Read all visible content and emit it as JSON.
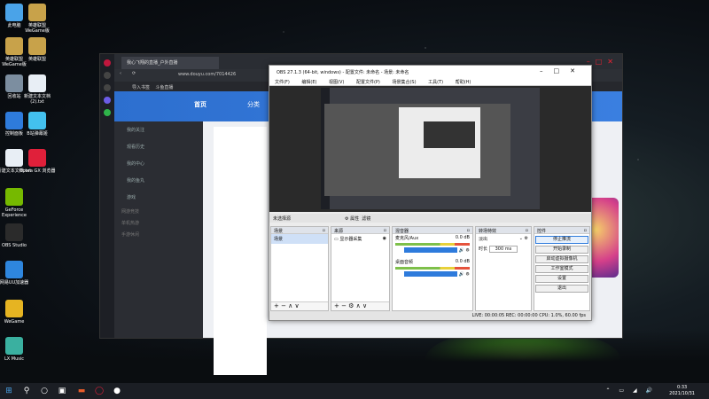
{
  "desktop_icons": [
    {
      "label": "此电脑",
      "color": "#4aa3e8"
    },
    {
      "label": "英雄联盟 WeGame版",
      "color": "#c8a24a"
    },
    {
      "label": "英雄联盟 WeGame版",
      "color": "#c8a24a"
    },
    {
      "label": "英雄联盟",
      "color": "#c8a24a"
    },
    {
      "label": "回收站",
      "color": "#7c8ea0"
    },
    {
      "label": "新建文本文档 (2).txt",
      "color": "#e8eef5"
    },
    {
      "label": "控制面板",
      "color": "#2e7bdc"
    },
    {
      "label": "B站弹幕姬",
      "color": "#43c1ef"
    },
    {
      "label": "新建文本文档.txt",
      "color": "#e8eef5"
    },
    {
      "label": "Opera GX 浏览器",
      "color": "#e0203a"
    },
    {
      "label": "GeForce Experience",
      "color": "#76b900"
    },
    {
      "label": "OBS Studio",
      "color": "#2b2b2b"
    },
    {
      "label": "网易UU加速器",
      "color": "#2e86de"
    },
    {
      "label": "WeGame",
      "color": "#e6b422"
    },
    {
      "label": "LX Music",
      "color": "#3ab0a0"
    }
  ],
  "browser": {
    "tab_title": "我心飞翔的直播_户外直播",
    "url": "www.douyu.com/7014426",
    "bookmarks": [
      "导入书签",
      "斗鱼直播"
    ],
    "site_nav": [
      "首页",
      "分类"
    ],
    "side_items": [
      "我的关注",
      "观看历史",
      "我的中心",
      "我的鱼丸",
      "游戏"
    ],
    "side_sections": [
      "网游竞技",
      "单机热游",
      "手游休闲"
    ]
  },
  "obs": {
    "title": "OBS 27.1.3 (64-bit, windows) - 配置文件: 未命名 - 场景: 未命名",
    "menu": [
      "文件(F)",
      "编辑(E)",
      "视图(V)",
      "配置文件(P)",
      "场景集合(S)",
      "工具(T)",
      "帮助(H)"
    ],
    "scene_bar": {
      "label": "未选择源",
      "props": "属性",
      "filters": "滤镜"
    },
    "scenes": {
      "header": "场景",
      "items": [
        "场景"
      ]
    },
    "sources": {
      "header": "来源",
      "items": [
        "显示器采集"
      ]
    },
    "mixer": {
      "header": "混音器",
      "channels": [
        {
          "name": "麦克风/Aux",
          "level": "0.0 dB"
        },
        {
          "name": "桌面音频",
          "level": "0.0 dB"
        }
      ]
    },
    "transitions": {
      "header": "转场特效",
      "type": "淡出",
      "duration_label": "时长",
      "duration": "300 ms"
    },
    "controls": {
      "header": "控件",
      "buttons": [
        "停止推流",
        "开始录制",
        "启动虚拟摄像机",
        "工作室模式",
        "设置",
        "退出"
      ]
    },
    "status": "LIVE: 00:00:05   REC: 00:00:00   CPU: 1.0%, 60.00 fps"
  },
  "taskbar": {
    "time": "0:33",
    "date": "2021/10/31"
  }
}
